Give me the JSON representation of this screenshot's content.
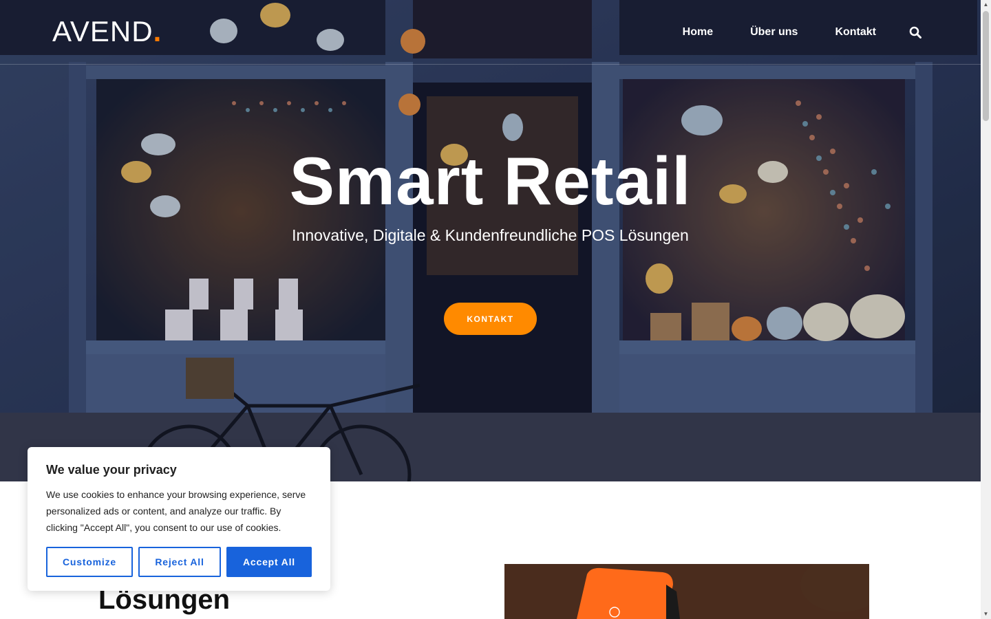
{
  "brand": {
    "name": "AVEND",
    "dot": ".",
    "accent_color": "#ff7a00"
  },
  "nav": {
    "items": [
      {
        "label": "Home"
      },
      {
        "label": "Über uns"
      },
      {
        "label": "Kontakt"
      }
    ],
    "search_icon": "search-icon"
  },
  "hero": {
    "title": "Smart Retail",
    "subtitle": "Innovative, Digitale & Kundenfreundliche POS Lösungen",
    "cta_label": "KONTAKT",
    "cta_color": "#ff8a00"
  },
  "section": {
    "heading": "Lösungen"
  },
  "cookie": {
    "title": "We value your privacy",
    "text": "We use cookies to enhance your browsing experience, serve personalized ads or content, and analyze our traffic. By clicking \"Accept All\", you consent to our use of cookies.",
    "customize_label": "Customize",
    "reject_label": "Reject All",
    "accept_label": "Accept All",
    "button_color": "#1863dc"
  }
}
